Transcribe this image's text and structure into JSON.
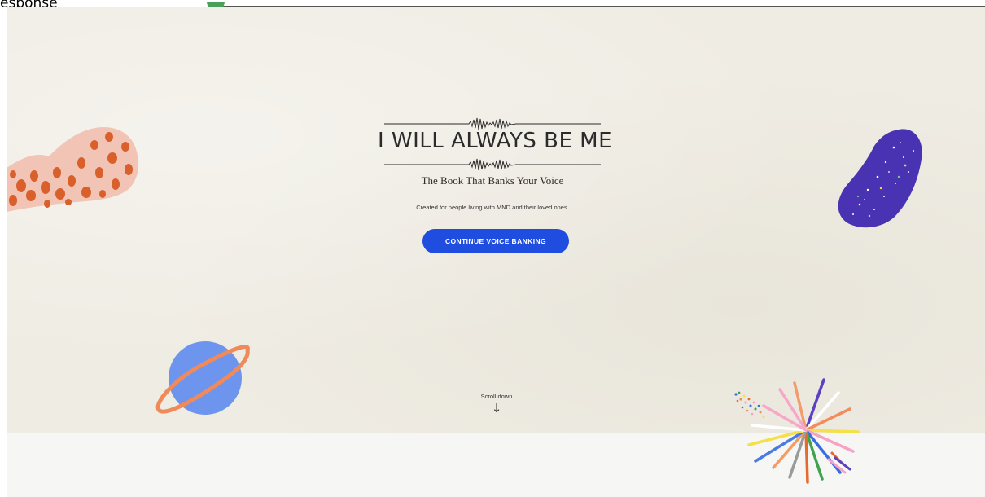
{
  "browser": {
    "cut_off_title": "esponse"
  },
  "hero": {
    "logo_text": "I WILL ALWAYS BE ME",
    "subtitle": "The Book That Banks Your Voice",
    "tagline": "Created for people living with MND and their loved ones.",
    "cta_label": "CONTINUE VOICE BANKING",
    "scroll_label": "Scroll down",
    "scroll_arrow": "↓"
  },
  "colors": {
    "background": "#efece3",
    "button": "#1f4de0",
    "footer_band": "#f6f6f4"
  },
  "decorations": [
    "leopard-blob-icon",
    "galaxy-blob-icon",
    "planet-icon",
    "starburst-icon"
  ]
}
